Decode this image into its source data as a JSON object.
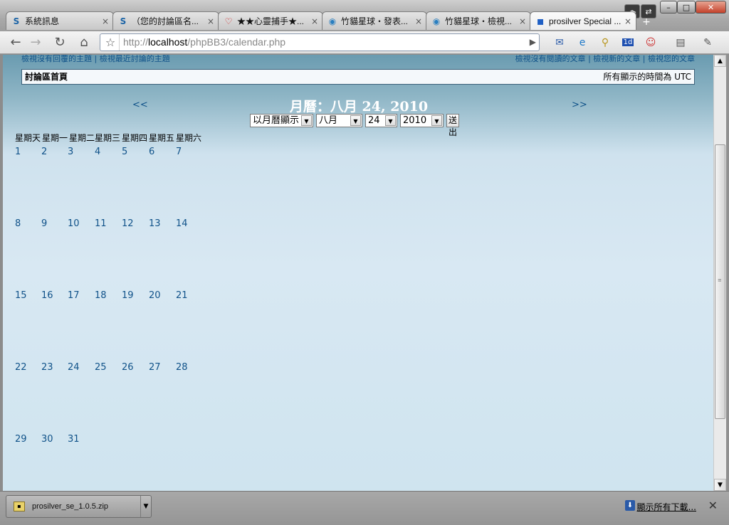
{
  "browser": {
    "tabs": [
      {
        "label": "系統訊息",
        "icon": "S"
      },
      {
        "label": "（您的討論區名...",
        "icon": "S"
      },
      {
        "label": "★★心靈捕手★...",
        "icon": "♡"
      },
      {
        "label": "竹貓星球・發表...",
        "icon": "◉"
      },
      {
        "label": "竹貓星球・檢視...",
        "icon": "◉"
      },
      {
        "label": "prosilver Special ...",
        "icon": "▪"
      }
    ],
    "tab_close": "×",
    "new_tab": "+",
    "url_prefix": "http://",
    "url_host": "localhost",
    "url_path": "/phpBB3/calendar.php",
    "window_buttons": {
      "minimize": "–",
      "maximize": "□",
      "close": "✕"
    },
    "toolbar_icons": [
      "back-icon",
      "forward-icon",
      "reload-icon",
      "home-icon",
      "star-icon",
      "mail-icon",
      "ie-icon",
      "search-ext-icon",
      "calendar-ext-icon",
      "avatar-ext-icon",
      "page-menu-icon",
      "wrench-icon"
    ],
    "ext_badge": "1d"
  },
  "page": {
    "top_link_left_1": "檢視沒有回覆的主題",
    "top_link_left_2": "檢視最近討論的主題",
    "top_link_right_1": "檢視沒有閱讀的文章",
    "top_link_right_2": "檢視新的文章",
    "top_link_right_3": "檢視您的文章",
    "separator": "|",
    "nav_home": "討論區首頁",
    "timezone": "所有顯示的時間為 UTC",
    "prev": "<<",
    "next": ">>",
    "calendar_title": "月曆：八月 24, 2010",
    "view_mode": "以月曆顯示",
    "month": "八月",
    "day": "24",
    "year": "2010",
    "submit": "送出",
    "weekdays": [
      "星期天",
      "星期一",
      "星期二",
      "星期三",
      "星期四",
      "星期五",
      "星期六"
    ],
    "weeks": [
      [
        "1",
        "2",
        "3",
        "4",
        "5",
        "6",
        "7"
      ],
      [
        "8",
        "9",
        "10",
        "11",
        "12",
        "13",
        "14"
      ],
      [
        "15",
        "16",
        "17",
        "18",
        "19",
        "20",
        "21"
      ],
      [
        "22",
        "23",
        "24",
        "25",
        "26",
        "27",
        "28"
      ],
      [
        "29",
        "30",
        "31"
      ]
    ]
  },
  "downloads": {
    "file": "prosilver_se_1.0.5.zip",
    "show_all": "顯示所有下載...",
    "close": "✕"
  }
}
